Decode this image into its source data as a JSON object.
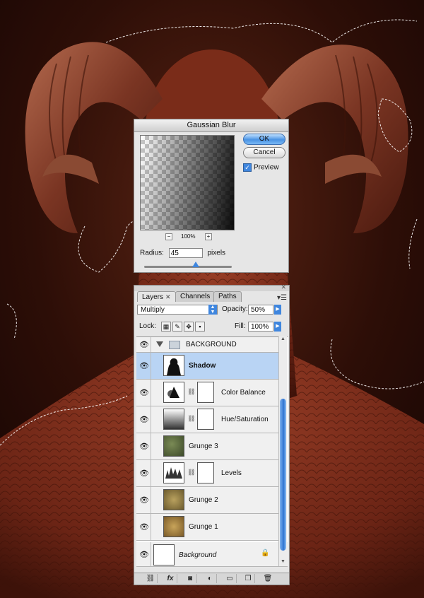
{
  "gaussian_blur": {
    "title": "Gaussian Blur",
    "ok_label": "OK",
    "cancel_label": "Cancel",
    "preview_label": "Preview",
    "preview_checked": true,
    "zoom_out": "−",
    "zoom_in": "+",
    "zoom_value": "100%",
    "radius_label": "Radius:",
    "radius_value": "45",
    "radius_unit": "pixels"
  },
  "layers_panel": {
    "tabs": [
      {
        "label": "Layers",
        "close": "✕"
      },
      {
        "label": "Channels"
      },
      {
        "label": "Paths"
      }
    ],
    "blend_mode": "Multiply",
    "opacity_label": "Opacity:",
    "opacity_value": "50%",
    "lock_label": "Lock:",
    "fill_label": "Fill:",
    "fill_value": "100%",
    "group_name": "BACKGROUND",
    "layers": [
      {
        "name": "Shadow"
      },
      {
        "name": "Color Balance"
      },
      {
        "name": "Hue/Saturation"
      },
      {
        "name": "Grunge 3"
      },
      {
        "name": "Levels"
      },
      {
        "name": "Grunge 2"
      },
      {
        "name": "Grunge 1"
      },
      {
        "name": "Background"
      }
    ],
    "footer_icons": [
      "link-icon",
      "fx-icon",
      "mask-icon",
      "adjustment-icon",
      "folder-icon",
      "new-layer-icon",
      "trash-icon"
    ]
  },
  "colors": {
    "accent_blue": "#3f86de",
    "selected_row": "#b9d4f4",
    "background_dark": "#2a0f09"
  }
}
